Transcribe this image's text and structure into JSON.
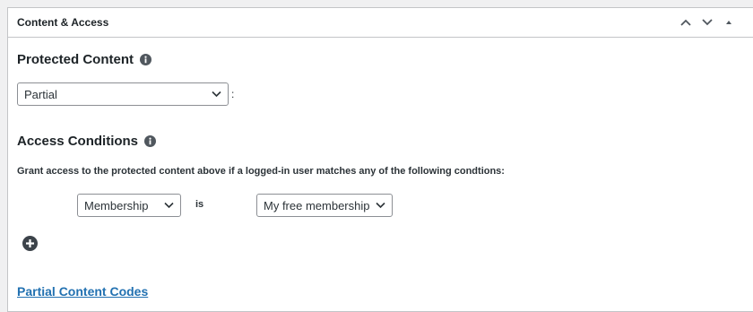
{
  "metabox": {
    "title": "Content & Access"
  },
  "protected_content": {
    "heading": "Protected Content",
    "select_value": "Partial",
    "colon": ":"
  },
  "access_conditions": {
    "heading": "Access Conditions",
    "description": "Grant access to the protected content above if a logged-in user matches any of the following condtions:",
    "condition": {
      "field": "Membership",
      "operator": "is",
      "value": "My free membership"
    }
  },
  "partial_codes": {
    "link_label": "Partial Content Codes"
  },
  "icons": {
    "move_up": "chevron-up-icon",
    "move_down": "chevron-down-icon",
    "toggle": "triangle-up-icon",
    "info": "info-icon",
    "add": "plus-circle-icon"
  },
  "colors": {
    "link": "#2271b1",
    "text": "#1d2327",
    "border": "#c3c4c7"
  }
}
